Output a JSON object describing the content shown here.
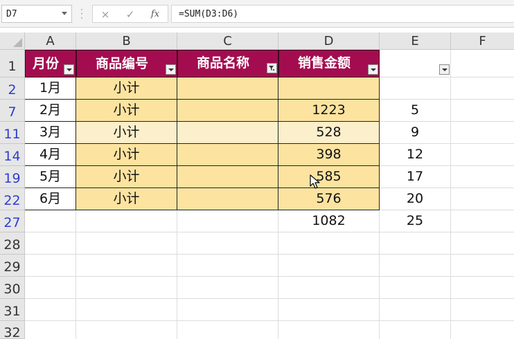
{
  "name_box": {
    "value": "D7"
  },
  "formula_bar": {
    "formula": "=SUM(D3:D6)",
    "cancel_icon": "×",
    "enter_icon": "✓",
    "fx_label": "fx"
  },
  "columns": [
    "A",
    "B",
    "C",
    "D",
    "E",
    "F"
  ],
  "rows": [
    "1",
    "2",
    "7",
    "11",
    "14",
    "19",
    "22",
    "27",
    "28",
    "29",
    "30",
    "31",
    "32"
  ],
  "header_row": [
    "月份",
    "商品编号",
    "商品名称",
    "销售金额"
  ],
  "data_rows": [
    {
      "month": "1月",
      "code": "小计",
      "name": "",
      "amount": "",
      "e": ""
    },
    {
      "month": "2月",
      "code": "小计",
      "name": "",
      "amount": "1223",
      "e": "5"
    },
    {
      "month": "3月",
      "code": "小计",
      "name": "",
      "amount": "528",
      "e": "9"
    },
    {
      "month": "4月",
      "code": "小计",
      "name": "",
      "amount": "398",
      "e": "12"
    },
    {
      "month": "5月",
      "code": "小计",
      "name": "",
      "amount": "585",
      "e": "17"
    },
    {
      "month": "6月",
      "code": "小计",
      "name": "",
      "amount": "576",
      "e": "20"
    }
  ],
  "total_row": {
    "amount": "1082",
    "e": "25"
  },
  "colors": {
    "header_fill": "#a30d4f",
    "cell_fill": "#fce3a0",
    "selected_row_fill": "#fcefcb",
    "filtered_row_number": "#2f3cd0"
  }
}
